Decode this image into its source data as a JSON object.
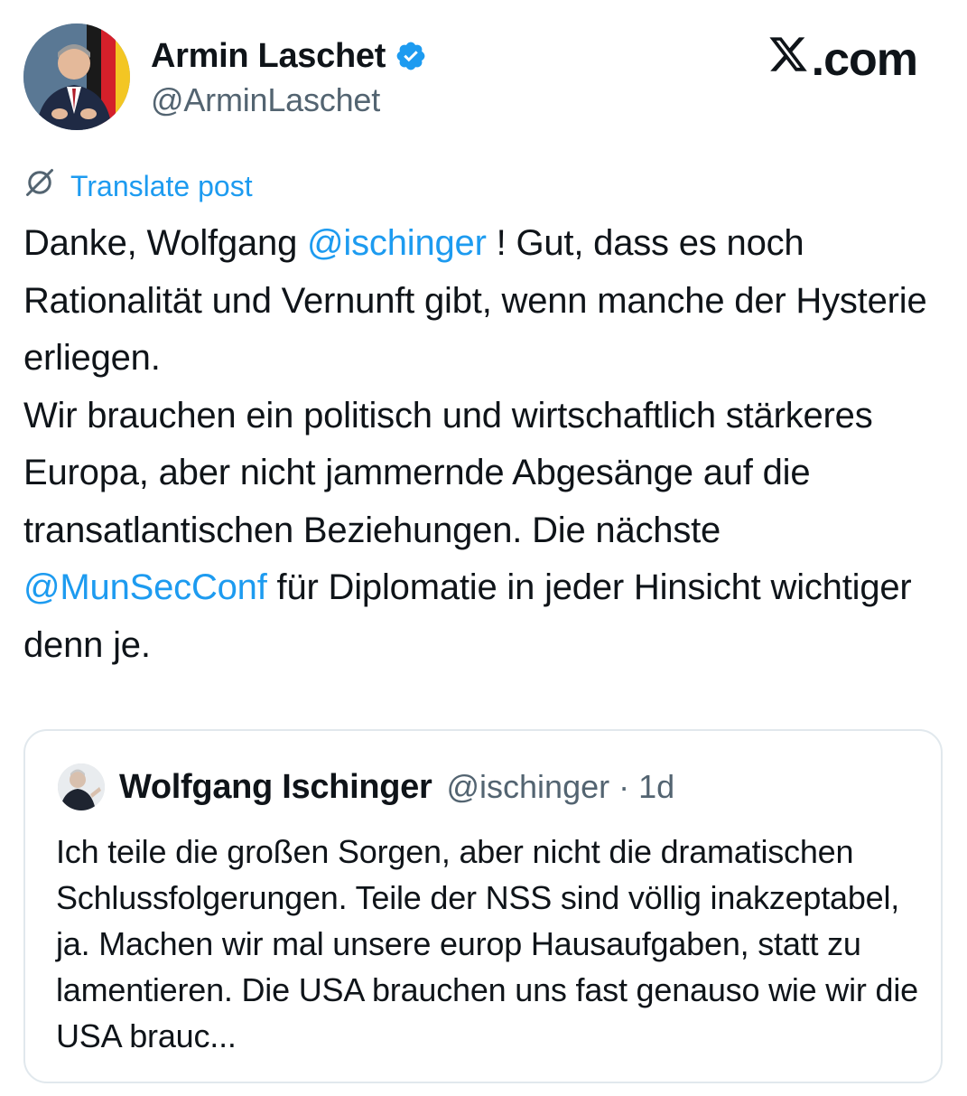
{
  "author": {
    "display_name": "Armin Laschet",
    "handle": "@ArminLaschet"
  },
  "brand": {
    "label": ".com"
  },
  "translate": {
    "label": "Translate post"
  },
  "post": {
    "p1": "Danke, Wolfgang ",
    "m1": "@ischinger",
    "p2": " ! Gut, dass es noch Rationalität und Vernunft gibt, wenn manche der Hysterie erliegen.",
    "p3": "Wir brauchen ein politisch und wirtschaftlich stärkeres Europa, aber nicht jammernde Abgesänge auf die transatlantischen Beziehungen. Die nächste ",
    "m2": "@MunSecConf",
    "p4": " für Diplomatie in jeder Hinsicht wichtiger denn je."
  },
  "quote": {
    "display_name": "Wolfgang Ischinger",
    "handle": "@ischinger",
    "separator": "·",
    "time": "1d",
    "text": "Ich teile die großen Sorgen, aber nicht die dramatischen Schlussfolgerungen. Teile der NSS sind völlig inakzeptabel, ja. Machen wir mal unsere europ Hausaufgaben, statt zu lamentieren. Die USA brauchen uns fast genauso wie wir die USA brauc..."
  },
  "colors": {
    "accent": "#1d9bf0",
    "text": "#0f1419",
    "secondary": "#536471",
    "border": "#e1e8ed"
  },
  "icons": [
    "verified-badge-icon",
    "x-logo-icon",
    "translate-globe-icon"
  ]
}
